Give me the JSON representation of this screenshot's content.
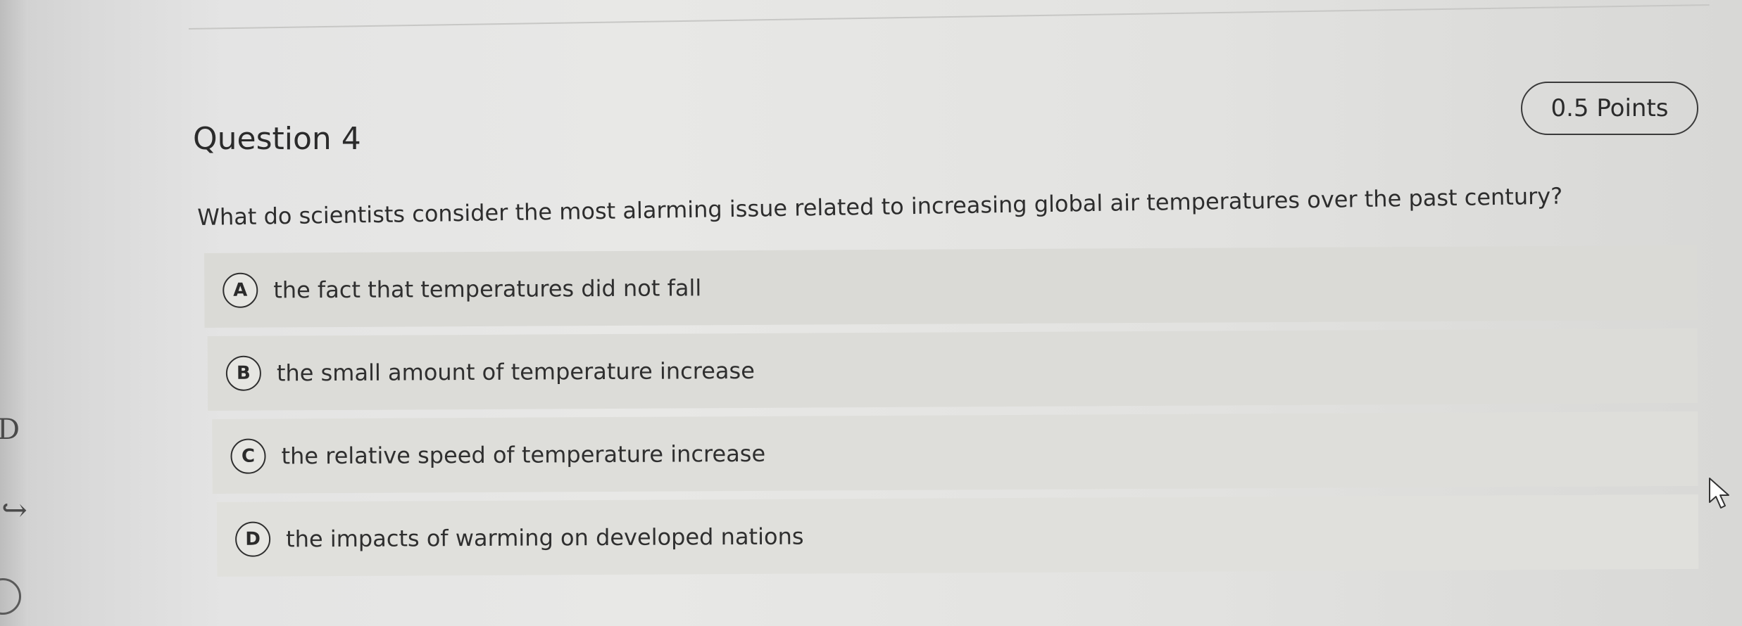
{
  "question": {
    "title": "Question 4",
    "points": "0.5 Points",
    "text": "What do scientists consider the most alarming issue related to increasing global air temperatures over the past century?"
  },
  "options": [
    {
      "letter": "A",
      "text": "the fact that temperatures did not fall"
    },
    {
      "letter": "B",
      "text": "the small amount of temperature increase"
    },
    {
      "letter": "C",
      "text": "the relative speed of temperature increase"
    },
    {
      "letter": "D",
      "text": "the impacts of warming on developed nations"
    }
  ],
  "edge": {
    "glyph_d": "D"
  },
  "colors": {
    "background": "#e6e6e4",
    "option_background": "#dcdcd8",
    "text": "#2f2f2f"
  },
  "icons": {
    "pointer": "arrow-cursor-icon"
  }
}
